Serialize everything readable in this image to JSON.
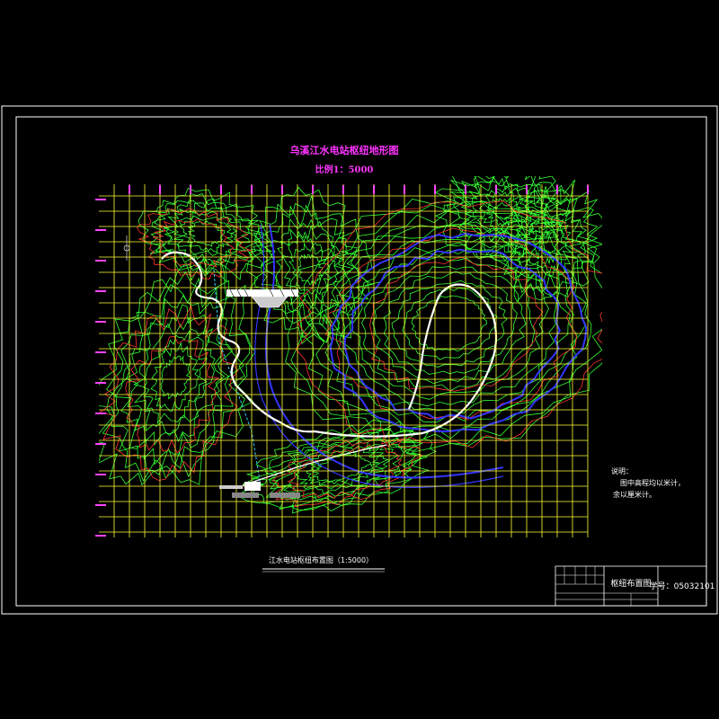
{
  "drawing": {
    "title": "乌溪江水电站枢纽地形图",
    "scale_text": "比例1：5000",
    "caption": "江水电站枢纽布置图（1:5000）",
    "notes": {
      "heading": "说明：",
      "line1": "图中高程均以米计，",
      "line2": "余以厘米计。"
    },
    "title_block": {
      "drawing_name": "枢纽布置图",
      "student_no": "学号：05032101"
    },
    "colors": {
      "frame": "#ffffff",
      "grid": "#ffff33",
      "contour_green": "#33ff33",
      "contour_red": "#ff3333",
      "water_blue": "#3333ff",
      "road": "#ffffff",
      "label_magenta": "#ff33ff"
    },
    "icons": [
      "north-arrow-icon",
      "dam-axis-symbol",
      "powerhouse-symbol"
    ]
  }
}
